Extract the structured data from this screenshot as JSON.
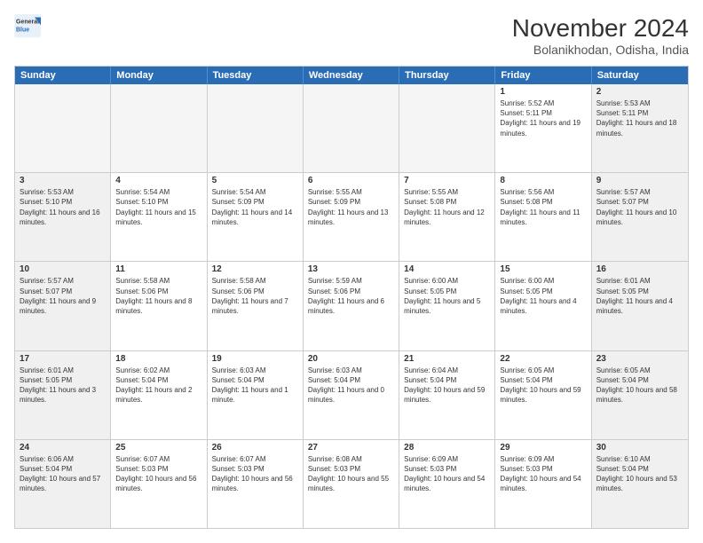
{
  "logo": {
    "line1": "General",
    "line2": "Blue"
  },
  "title": "November 2024",
  "subtitle": "Bolanikhodan, Odisha, India",
  "days_of_week": [
    "Sunday",
    "Monday",
    "Tuesday",
    "Wednesday",
    "Thursday",
    "Friday",
    "Saturday"
  ],
  "weeks": [
    [
      {
        "day": "",
        "empty": true
      },
      {
        "day": "",
        "empty": true
      },
      {
        "day": "",
        "empty": true
      },
      {
        "day": "",
        "empty": true
      },
      {
        "day": "",
        "empty": true
      },
      {
        "day": "1",
        "sunrise": "5:52 AM",
        "sunset": "5:11 PM",
        "daylight": "11 hours and 19 minutes."
      },
      {
        "day": "2",
        "sunrise": "5:53 AM",
        "sunset": "5:11 PM",
        "daylight": "11 hours and 18 minutes."
      }
    ],
    [
      {
        "day": "3",
        "sunrise": "5:53 AM",
        "sunset": "5:10 PM",
        "daylight": "11 hours and 16 minutes."
      },
      {
        "day": "4",
        "sunrise": "5:54 AM",
        "sunset": "5:10 PM",
        "daylight": "11 hours and 15 minutes."
      },
      {
        "day": "5",
        "sunrise": "5:54 AM",
        "sunset": "5:09 PM",
        "daylight": "11 hours and 14 minutes."
      },
      {
        "day": "6",
        "sunrise": "5:55 AM",
        "sunset": "5:09 PM",
        "daylight": "11 hours and 13 minutes."
      },
      {
        "day": "7",
        "sunrise": "5:55 AM",
        "sunset": "5:08 PM",
        "daylight": "11 hours and 12 minutes."
      },
      {
        "day": "8",
        "sunrise": "5:56 AM",
        "sunset": "5:08 PM",
        "daylight": "11 hours and 11 minutes."
      },
      {
        "day": "9",
        "sunrise": "5:57 AM",
        "sunset": "5:07 PM",
        "daylight": "11 hours and 10 minutes."
      }
    ],
    [
      {
        "day": "10",
        "sunrise": "5:57 AM",
        "sunset": "5:07 PM",
        "daylight": "11 hours and 9 minutes."
      },
      {
        "day": "11",
        "sunrise": "5:58 AM",
        "sunset": "5:06 PM",
        "daylight": "11 hours and 8 minutes."
      },
      {
        "day": "12",
        "sunrise": "5:58 AM",
        "sunset": "5:06 PM",
        "daylight": "11 hours and 7 minutes."
      },
      {
        "day": "13",
        "sunrise": "5:59 AM",
        "sunset": "5:06 PM",
        "daylight": "11 hours and 6 minutes."
      },
      {
        "day": "14",
        "sunrise": "6:00 AM",
        "sunset": "5:05 PM",
        "daylight": "11 hours and 5 minutes."
      },
      {
        "day": "15",
        "sunrise": "6:00 AM",
        "sunset": "5:05 PM",
        "daylight": "11 hours and 4 minutes."
      },
      {
        "day": "16",
        "sunrise": "6:01 AM",
        "sunset": "5:05 PM",
        "daylight": "11 hours and 4 minutes."
      }
    ],
    [
      {
        "day": "17",
        "sunrise": "6:01 AM",
        "sunset": "5:05 PM",
        "daylight": "11 hours and 3 minutes."
      },
      {
        "day": "18",
        "sunrise": "6:02 AM",
        "sunset": "5:04 PM",
        "daylight": "11 hours and 2 minutes."
      },
      {
        "day": "19",
        "sunrise": "6:03 AM",
        "sunset": "5:04 PM",
        "daylight": "11 hours and 1 minute."
      },
      {
        "day": "20",
        "sunrise": "6:03 AM",
        "sunset": "5:04 PM",
        "daylight": "11 hours and 0 minutes."
      },
      {
        "day": "21",
        "sunrise": "6:04 AM",
        "sunset": "5:04 PM",
        "daylight": "10 hours and 59 minutes."
      },
      {
        "day": "22",
        "sunrise": "6:05 AM",
        "sunset": "5:04 PM",
        "daylight": "10 hours and 59 minutes."
      },
      {
        "day": "23",
        "sunrise": "6:05 AM",
        "sunset": "5:04 PM",
        "daylight": "10 hours and 58 minutes."
      }
    ],
    [
      {
        "day": "24",
        "sunrise": "6:06 AM",
        "sunset": "5:04 PM",
        "daylight": "10 hours and 57 minutes."
      },
      {
        "day": "25",
        "sunrise": "6:07 AM",
        "sunset": "5:03 PM",
        "daylight": "10 hours and 56 minutes."
      },
      {
        "day": "26",
        "sunrise": "6:07 AM",
        "sunset": "5:03 PM",
        "daylight": "10 hours and 56 minutes."
      },
      {
        "day": "27",
        "sunrise": "6:08 AM",
        "sunset": "5:03 PM",
        "daylight": "10 hours and 55 minutes."
      },
      {
        "day": "28",
        "sunrise": "6:09 AM",
        "sunset": "5:03 PM",
        "daylight": "10 hours and 54 minutes."
      },
      {
        "day": "29",
        "sunrise": "6:09 AM",
        "sunset": "5:03 PM",
        "daylight": "10 hours and 54 minutes."
      },
      {
        "day": "30",
        "sunrise": "6:10 AM",
        "sunset": "5:04 PM",
        "daylight": "10 hours and 53 minutes."
      }
    ]
  ]
}
